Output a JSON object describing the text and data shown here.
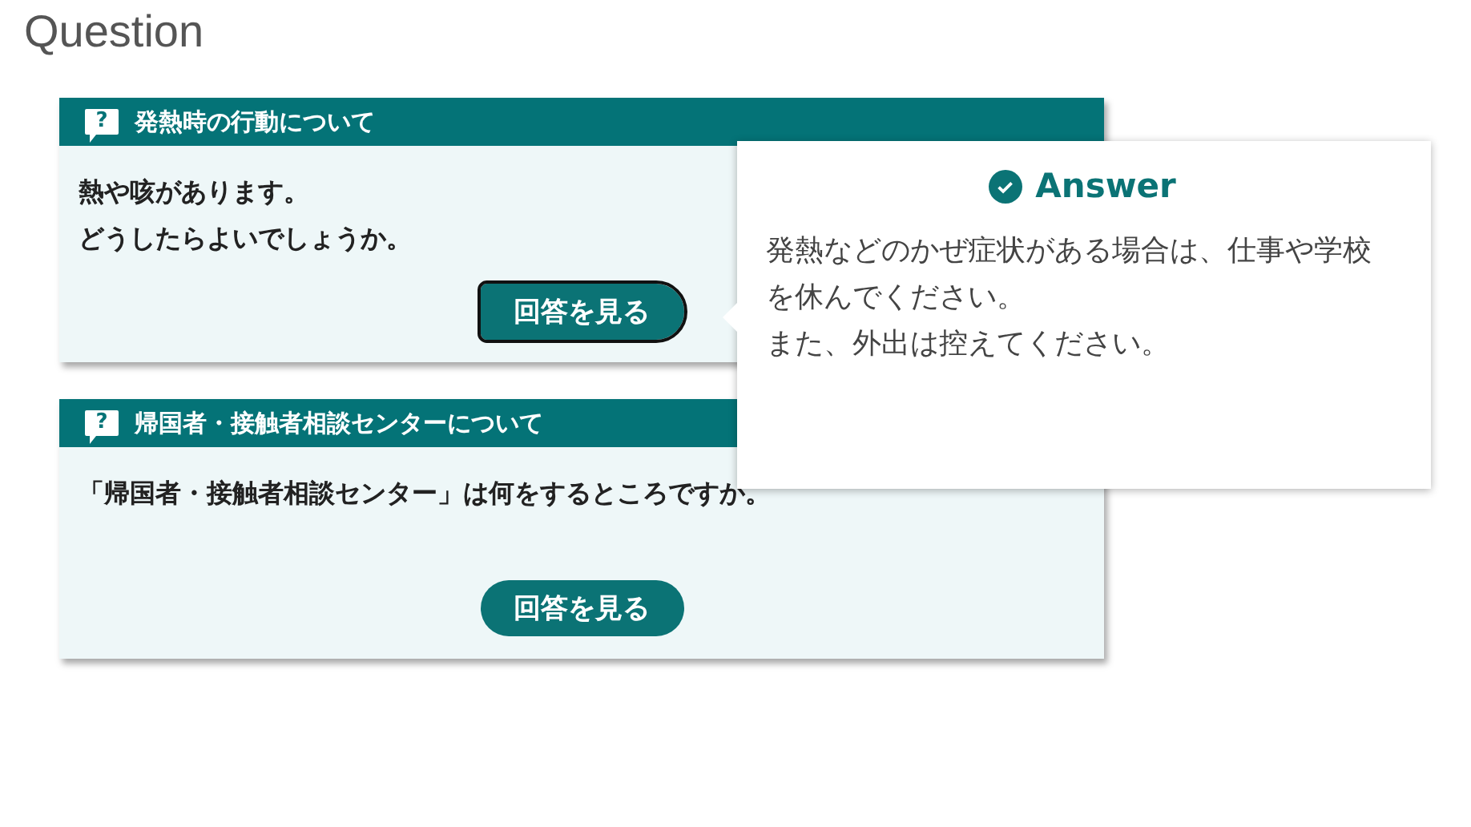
{
  "page_title": "Question",
  "cards": [
    {
      "icon_text": "?",
      "heading": "発熱時の行動について",
      "question_lines": [
        "熱や咳があります。",
        "どうしたらよいでしょうか。"
      ],
      "button": {
        "label": "回答を見る",
        "focused": true
      },
      "answer": {
        "title": "Answer",
        "paragraphs": [
          "発熱などのかぜ症状がある場合は、仕事や学校を休んでください。",
          "また、外出は控えてください。"
        ]
      }
    },
    {
      "icon_text": "?",
      "heading": "帰国者・接触者相談センターについて",
      "question_lines": [
        "「帰国者・接触者相談センター」は何をするところですか。"
      ],
      "button": {
        "label": "回答を見る",
        "focused": false
      }
    }
  ]
}
